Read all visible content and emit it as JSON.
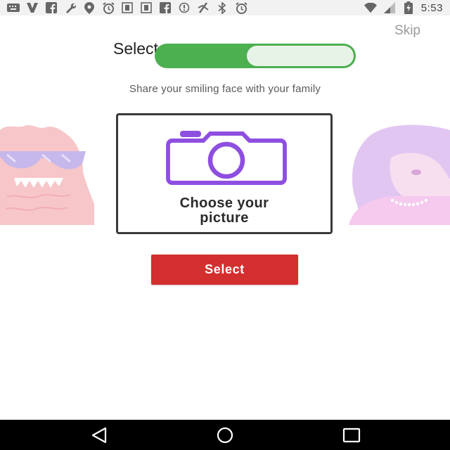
{
  "status_bar": {
    "time": "5:53",
    "icons": [
      "keyboard-icon",
      "v-app-icon",
      "facebook-icon",
      "wrench-icon",
      "location-icon",
      "alarm-icon",
      "image-icon",
      "image-icon",
      "facebook-icon",
      "sync-icon",
      "signal-off-icon",
      "bluetooth-icon",
      "alarm-icon",
      "wifi-icon",
      "cell-signal-icon",
      "battery-icon"
    ]
  },
  "header": {
    "skip_label": "Skip",
    "title": "Select"
  },
  "subtitle": "Share your smiling face with your family",
  "picture_card": {
    "line1": "Choose your",
    "line2": "picture",
    "icon": "camera-icon"
  },
  "select_button": {
    "label": "Select"
  },
  "colors": {
    "accent_red": "#d32f2f",
    "toggle_green": "#4caf50",
    "camera_purple": "#8e4fe0"
  },
  "nav_bar": {
    "icons": [
      "back-icon",
      "home-icon",
      "recents-icon"
    ]
  }
}
